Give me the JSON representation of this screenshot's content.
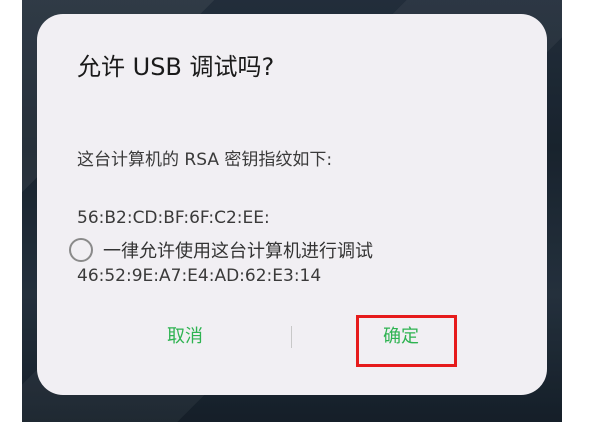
{
  "dialog": {
    "title": "允许 USB 调试吗?",
    "message_line1": "这台计算机的 RSA 密钥指纹如下:",
    "message_line2": "56:B2:CD:BF:6F:C2:EE:",
    "message_line3": "46:52:9E:A7:E4:AD:62:E3:14",
    "checkbox_label": "一律允许使用这台计算机进行调试",
    "checkbox_checked": false,
    "cancel_label": "取消",
    "ok_label": "确定"
  },
  "colors": {
    "accent": "#2eb351",
    "highlight": "#e61b1b",
    "dialog_bg": "#f1eff3"
  }
}
